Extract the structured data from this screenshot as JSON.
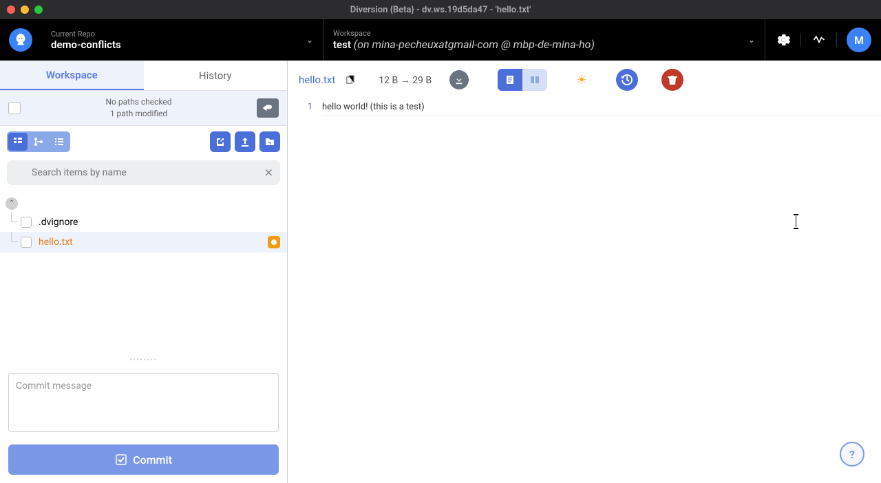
{
  "window": {
    "title": "Diversion {Beta} - dv.ws.19d5da47 - 'hello.txt'"
  },
  "topbar": {
    "repo_label": "Current Repo",
    "repo_name": "demo-conflicts",
    "workspace_label": "Workspace",
    "workspace_name": "test",
    "workspace_detail": " (on mina-pecheuxatgmail-com @ mbp-de-mina-ho)",
    "avatar_initial": "M"
  },
  "sidebar": {
    "tabs": {
      "workspace": "Workspace",
      "history": "History"
    },
    "status": {
      "line1": "No paths checked",
      "line2": "1 path modified"
    },
    "search_placeholder": "Search items by name",
    "files": [
      {
        "name": ".dvignore",
        "modified": false
      },
      {
        "name": "hello.txt",
        "modified": true
      }
    ],
    "commit_placeholder": "Commit message",
    "commit_button": "Commit"
  },
  "content": {
    "filename": "hello.txt",
    "size_from": "12 B",
    "size_to": "29 B",
    "arrow": "→",
    "lines": [
      {
        "no": "1",
        "text": "hello world! (this is a test)"
      }
    ]
  },
  "help_label": "?"
}
